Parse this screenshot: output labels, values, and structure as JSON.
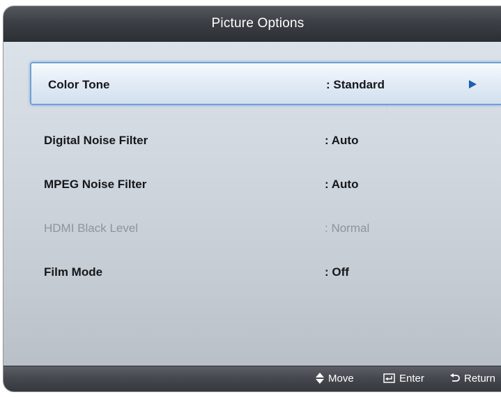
{
  "title": "Picture Options",
  "menu": {
    "items": [
      {
        "label": "Color Tone",
        "value": ": Standard",
        "state": "selected"
      },
      {
        "label": "Digital Noise Filter",
        "value": ": Auto",
        "state": "normal"
      },
      {
        "label": "MPEG Noise Filter",
        "value": ": Auto",
        "state": "normal"
      },
      {
        "label": "HDMI Black Level",
        "value": ": Normal",
        "state": "disabled"
      },
      {
        "label": "Film Mode",
        "value": ": Off",
        "state": "normal"
      }
    ],
    "submenu_icon": "right-triangle-icon"
  },
  "footer": {
    "move_label": "Move",
    "move_icon": "up-down-arrows-icon",
    "enter_label": "Enter",
    "enter_icon": "enter-icon",
    "return_label": "Return",
    "return_icon": "return-arrow-icon"
  },
  "colors": {
    "selection_border": "#6fa0d6",
    "arrow": "#1b5fae",
    "title_bar": "#3c4046",
    "disabled_text": "#8e949c"
  }
}
